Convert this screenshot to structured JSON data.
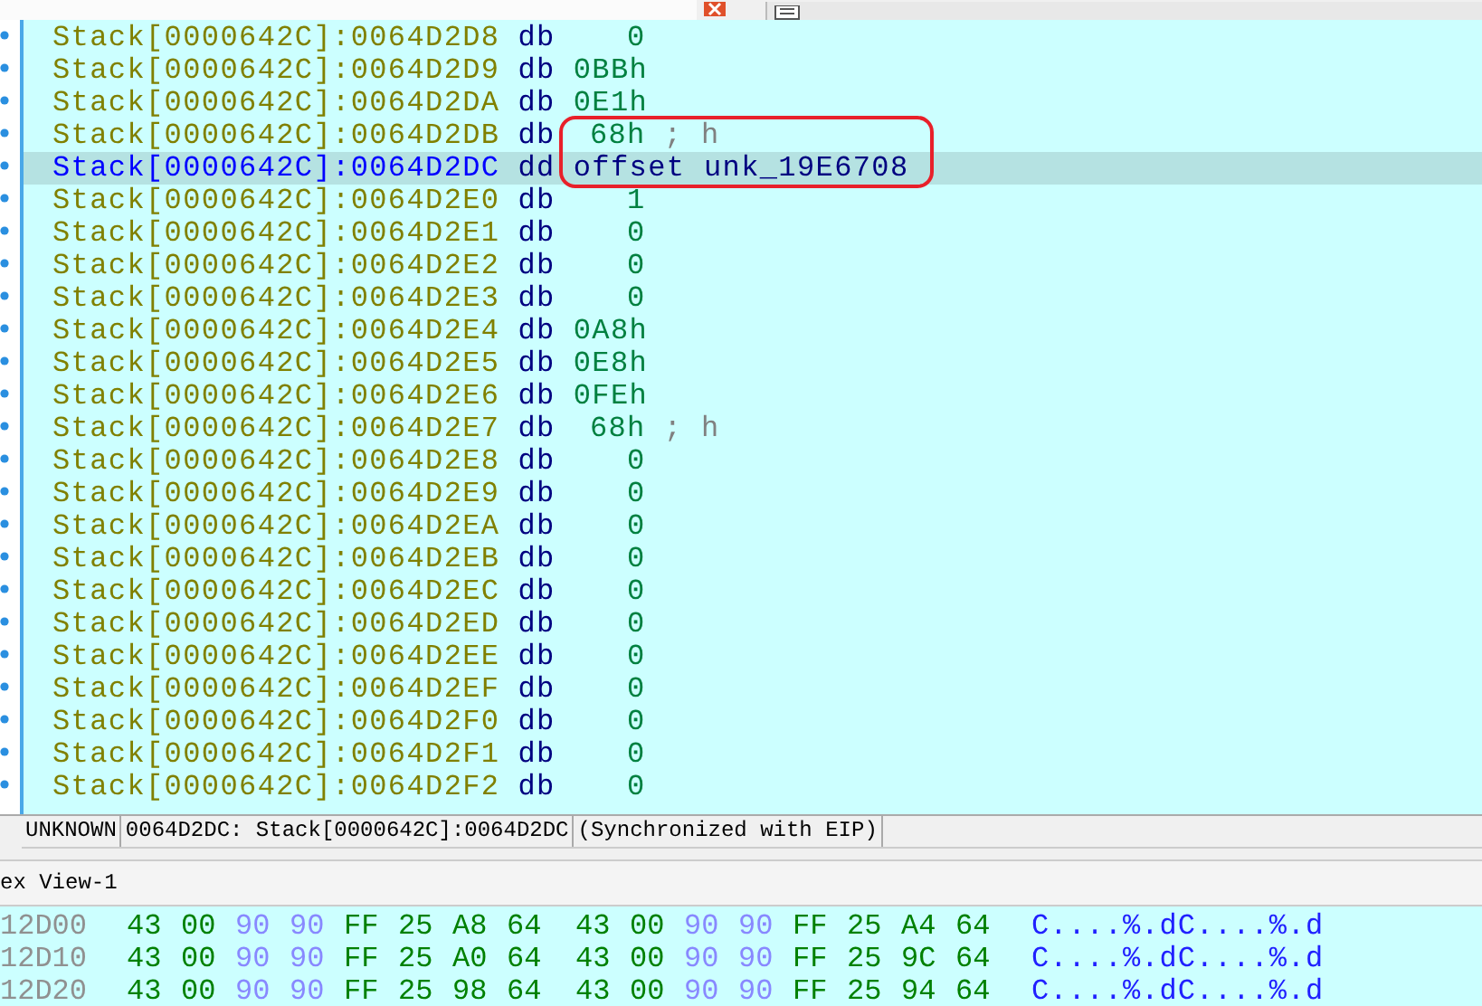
{
  "listing": {
    "rows": [
      {
        "address": "Stack[0000642C]:0064D2D8",
        "mnemonic": "db",
        "operand": "0",
        "comment": "",
        "selected": false
      },
      {
        "address": "Stack[0000642C]:0064D2D9",
        "mnemonic": "db",
        "operand": "0BBh",
        "comment": "",
        "selected": false
      },
      {
        "address": "Stack[0000642C]:0064D2DA",
        "mnemonic": "db",
        "operand": "0E1h",
        "comment": "",
        "selected": false
      },
      {
        "address": "Stack[0000642C]:0064D2DB",
        "mnemonic": "db",
        "operand": "68h",
        "comment": "; h",
        "selected": false
      },
      {
        "address": "Stack[0000642C]:0064D2DC",
        "mnemonic": "dd",
        "operand": "offset unk_19E6708",
        "comment": "",
        "selected": true
      },
      {
        "address": "Stack[0000642C]:0064D2E0",
        "mnemonic": "db",
        "operand": "1",
        "comment": "",
        "selected": false
      },
      {
        "address": "Stack[0000642C]:0064D2E1",
        "mnemonic": "db",
        "operand": "0",
        "comment": "",
        "selected": false
      },
      {
        "address": "Stack[0000642C]:0064D2E2",
        "mnemonic": "db",
        "operand": "0",
        "comment": "",
        "selected": false
      },
      {
        "address": "Stack[0000642C]:0064D2E3",
        "mnemonic": "db",
        "operand": "0",
        "comment": "",
        "selected": false
      },
      {
        "address": "Stack[0000642C]:0064D2E4",
        "mnemonic": "db",
        "operand": "0A8h",
        "comment": "",
        "selected": false
      },
      {
        "address": "Stack[0000642C]:0064D2E5",
        "mnemonic": "db",
        "operand": "0E8h",
        "comment": "",
        "selected": false
      },
      {
        "address": "Stack[0000642C]:0064D2E6",
        "mnemonic": "db",
        "operand": "0FEh",
        "comment": "",
        "selected": false
      },
      {
        "address": "Stack[0000642C]:0064D2E7",
        "mnemonic": "db",
        "operand": "68h",
        "comment": "; h",
        "selected": false
      },
      {
        "address": "Stack[0000642C]:0064D2E8",
        "mnemonic": "db",
        "operand": "0",
        "comment": "",
        "selected": false
      },
      {
        "address": "Stack[0000642C]:0064D2E9",
        "mnemonic": "db",
        "operand": "0",
        "comment": "",
        "selected": false
      },
      {
        "address": "Stack[0000642C]:0064D2EA",
        "mnemonic": "db",
        "operand": "0",
        "comment": "",
        "selected": false
      },
      {
        "address": "Stack[0000642C]:0064D2EB",
        "mnemonic": "db",
        "operand": "0",
        "comment": "",
        "selected": false
      },
      {
        "address": "Stack[0000642C]:0064D2EC",
        "mnemonic": "db",
        "operand": "0",
        "comment": "",
        "selected": false
      },
      {
        "address": "Stack[0000642C]:0064D2ED",
        "mnemonic": "db",
        "operand": "0",
        "comment": "",
        "selected": false
      },
      {
        "address": "Stack[0000642C]:0064D2EE",
        "mnemonic": "db",
        "operand": "0",
        "comment": "",
        "selected": false
      },
      {
        "address": "Stack[0000642C]:0064D2EF",
        "mnemonic": "db",
        "operand": "0",
        "comment": "",
        "selected": false
      },
      {
        "address": "Stack[0000642C]:0064D2F0",
        "mnemonic": "db",
        "operand": "0",
        "comment": "",
        "selected": false
      },
      {
        "address": "Stack[0000642C]:0064D2F1",
        "mnemonic": "db",
        "operand": "0",
        "comment": "",
        "selected": false
      },
      {
        "address": "Stack[0000642C]:0064D2F2",
        "mnemonic": "db",
        "operand": "0",
        "comment": "",
        "selected": false
      }
    ]
  },
  "status_bar": [
    "UNKNOWN",
    "0064D2DC: Stack[0000642C]:0064D2DC",
    "(Synchronized with EIP)"
  ],
  "hex_view": {
    "title": "ex View-1",
    "rows": [
      {
        "address": "12D00",
        "bytes": [
          {
            "text": "43",
            "faded": false
          },
          {
            "text": "00",
            "faded": false
          },
          {
            "text": "90",
            "faded": true
          },
          {
            "text": "90",
            "faded": true
          },
          {
            "text": "FF",
            "faded": false
          },
          {
            "text": "25",
            "faded": false
          },
          {
            "text": "A8",
            "faded": false
          },
          {
            "text": "64",
            "faded": false
          },
          {
            "text": "43",
            "faded": false
          },
          {
            "text": "00",
            "faded": false
          },
          {
            "text": "90",
            "faded": true
          },
          {
            "text": "90",
            "faded": true
          },
          {
            "text": "FF",
            "faded": false
          },
          {
            "text": "25",
            "faded": false
          },
          {
            "text": "A4",
            "faded": false
          },
          {
            "text": "64",
            "faded": false
          }
        ],
        "ascii": "C....%.dC....%.d"
      },
      {
        "address": "12D10",
        "bytes": [
          {
            "text": "43",
            "faded": false
          },
          {
            "text": "00",
            "faded": false
          },
          {
            "text": "90",
            "faded": true
          },
          {
            "text": "90",
            "faded": true
          },
          {
            "text": "FF",
            "faded": false
          },
          {
            "text": "25",
            "faded": false
          },
          {
            "text": "A0",
            "faded": false
          },
          {
            "text": "64",
            "faded": false
          },
          {
            "text": "43",
            "faded": false
          },
          {
            "text": "00",
            "faded": false
          },
          {
            "text": "90",
            "faded": true
          },
          {
            "text": "90",
            "faded": true
          },
          {
            "text": "FF",
            "faded": false
          },
          {
            "text": "25",
            "faded": false
          },
          {
            "text": "9C",
            "faded": false
          },
          {
            "text": "64",
            "faded": false
          }
        ],
        "ascii": "C....%.dC....%.d"
      },
      {
        "address": "12D20",
        "bytes": [
          {
            "text": "43",
            "faded": false
          },
          {
            "text": "00",
            "faded": false
          },
          {
            "text": "90",
            "faded": true
          },
          {
            "text": "90",
            "faded": true
          },
          {
            "text": "FF",
            "faded": false
          },
          {
            "text": "25",
            "faded": false
          },
          {
            "text": "98",
            "faded": false
          },
          {
            "text": "64",
            "faded": false
          },
          {
            "text": "43",
            "faded": false
          },
          {
            "text": "00",
            "faded": false
          },
          {
            "text": "90",
            "faded": true
          },
          {
            "text": "90",
            "faded": true
          },
          {
            "text": "FF",
            "faded": false
          },
          {
            "text": "25",
            "faded": false
          },
          {
            "text": "94",
            "faded": false
          },
          {
            "text": "64",
            "faded": false
          }
        ],
        "ascii": "C....%.dC....%.d"
      }
    ]
  }
}
